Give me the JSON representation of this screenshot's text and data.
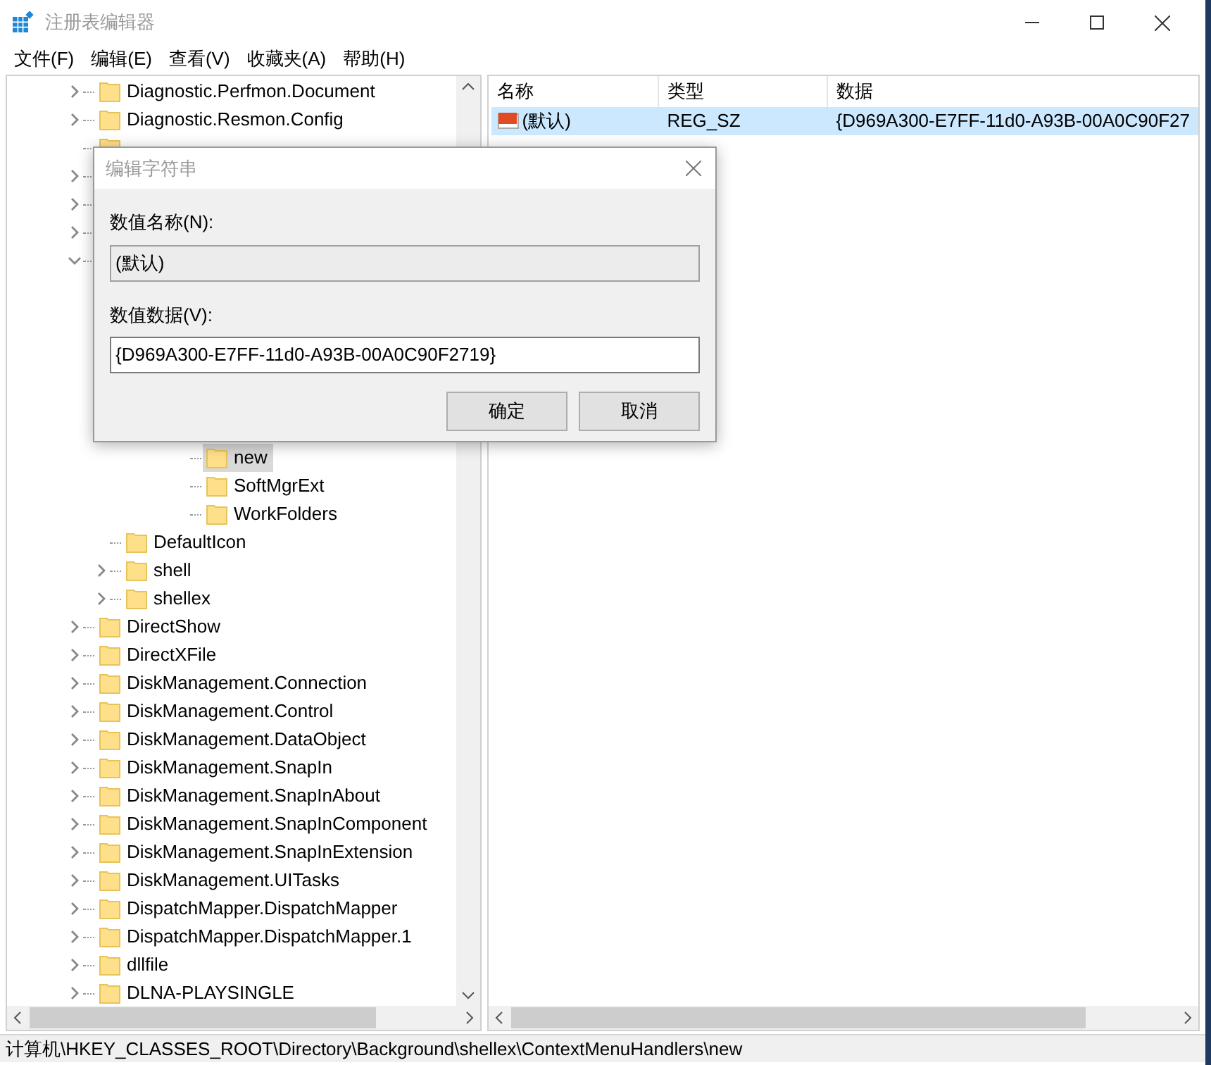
{
  "window": {
    "title": "注册表编辑器"
  },
  "menu": [
    "文件(F)",
    "编辑(E)",
    "查看(V)",
    "收藏夹(A)",
    "帮助(H)"
  ],
  "tree": [
    {
      "label": "Diagnostic.Perfmon.Document",
      "expanded": false
    },
    {
      "label": "Diagnostic.Resmon.Config",
      "expanded": false
    },
    {
      "kind": "folder"
    },
    {
      "expanded": false
    },
    {
      "expanded": false
    },
    {
      "expanded": false
    },
    {
      "expanded": true,
      "children": [
        {
          "children": [
            {
              "children": [
                {
                  "children": [
                    {
                      "label": "new",
                      "selected": true
                    },
                    {
                      "label": "SoftMgrExt",
                      "selected": false
                    },
                    {
                      "label": "WorkFolders",
                      "selected": false
                    }
                  ]
                }
              ]
            }
          ]
        },
        {
          "label": "DefaultIcon"
        },
        {
          "label": "shell",
          "expanded": false
        },
        {
          "label": "shellex",
          "expanded": false
        }
      ]
    },
    {
      "label": "DirectShow",
      "expanded": false
    },
    {
      "label": "DirectXFile",
      "expanded": false
    },
    {
      "label": "DiskManagement.Connection",
      "expanded": false
    },
    {
      "label": "DiskManagement.Control",
      "expanded": false
    },
    {
      "label": "DiskManagement.DataObject",
      "expanded": false
    },
    {
      "label": "DiskManagement.SnapIn",
      "expanded": false
    },
    {
      "label": "DiskManagement.SnapInAbout",
      "expanded": false
    },
    {
      "label": "DiskManagement.SnapInComponent",
      "expanded": false
    },
    {
      "label": "DiskManagement.SnapInExtension",
      "expanded": false
    },
    {
      "label": "DiskManagement.UITasks",
      "expanded": false
    },
    {
      "label": "DispatchMapper.DispatchMapper",
      "expanded": false
    },
    {
      "label": "DispatchMapper.DispatchMapper.1",
      "expanded": false
    },
    {
      "label": "dllfile",
      "expanded": false
    },
    {
      "label": "DLNA-PLAYSINGLE",
      "expanded": false
    }
  ],
  "values": {
    "columns": [
      "名称",
      "类型",
      "数据"
    ],
    "rows": [
      {
        "name": "(默认)",
        "type": "REG_SZ",
        "data": "{D969A300-E7FF-11d0-A93B-00A0C90F27",
        "selected": true
      }
    ]
  },
  "dialog": {
    "title": "编辑字符串",
    "name_label": "数值名称(N):",
    "name_value": "(默认)",
    "data_label": "数值数据(V):",
    "data_value": "{D969A300-E7FF-11d0-A93B-00A0C90F2719}",
    "buttons": [
      "确定",
      "取消"
    ]
  },
  "status_bar": "计算机\\HKEY_CLASSES_ROOT\\Directory\\Background\\shellex\\ContextMenuHandlers\\new"
}
